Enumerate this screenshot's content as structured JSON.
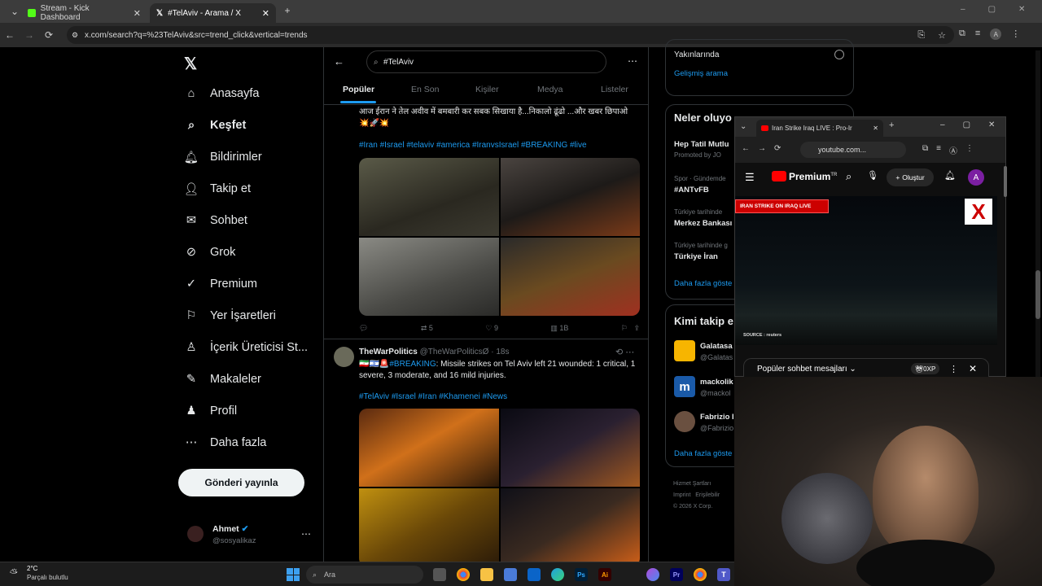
{
  "browser": {
    "tabs": [
      {
        "label": "Stream - Kick Dashboard",
        "icon": "kick-icon"
      },
      {
        "label": "#TelAviv - Arama / X",
        "icon": "x-icon"
      }
    ],
    "url": "x.com/search?q=%23TelAviv&src=trend_click&vertical=trends"
  },
  "sidebar": {
    "items": [
      {
        "label": "Anasayfa",
        "icon": "home-icon"
      },
      {
        "label": "Keşfet",
        "icon": "search-icon"
      },
      {
        "label": "Bildirimler",
        "icon": "bell-icon"
      },
      {
        "label": "Takip et",
        "icon": "follow-icon"
      },
      {
        "label": "Sohbet",
        "icon": "mail-icon"
      },
      {
        "label": "Grok",
        "icon": "grok-icon"
      },
      {
        "label": "Premium",
        "icon": "premium-icon"
      },
      {
        "label": "Yer İşaretleri",
        "icon": "bookmark-icon"
      },
      {
        "label": "İçerik Üreticisi St...",
        "icon": "creator-icon"
      },
      {
        "label": "Makaleler",
        "icon": "article-icon"
      },
      {
        "label": "Profil",
        "icon": "profile-icon"
      },
      {
        "label": "Daha fazla",
        "icon": "more-icon"
      }
    ],
    "post_button": "Gönderi yayınla",
    "account": {
      "name": "Ahmet",
      "handle": "@sosyalikaz"
    }
  },
  "search": {
    "query": "#TelAviv"
  },
  "search_tabs": [
    "Popüler",
    "En Son",
    "Kişiler",
    "Medya",
    "Listeler"
  ],
  "tweet1": {
    "text": "आज ईरान ने तेल अवीव में बमबारी कर सबक सिखाया है...निकालो ढूंढो ...और खबर छिपाओ",
    "emoji": "💥🚀💥",
    "tags": "#Iran #Israel #telaviv #america #IranvsIsrael #BREAKING #live",
    "replies": "",
    "retweets": "5",
    "likes": "9",
    "views": "1B"
  },
  "tweet2": {
    "name": "TheWarPolitics",
    "handle": "@TheWarPoliticsØ",
    "time": "· 18s",
    "flags": "🇮🇷🇮🇱🚨",
    "breaking": "#BREAKING",
    "text": ": Missile strikes on Tel Aviv left 21 wounded: 1 critical, 1 severe, 3 moderate, and 16 mild injuries.",
    "tags": "#TelAviv #Israel #Iran #Khamenei #News"
  },
  "right": {
    "filter_label": "Yakınlarında",
    "advanced_search": "Gelişmiş arama",
    "trends_title": "Neler oluyo",
    "trends": [
      {
        "meta": "",
        "name": "Hep Tatil Mutlu",
        "sub": "Promoted by JO"
      },
      {
        "meta": "Spor · Gündemde",
        "name": "#ANTvFB",
        "sub": ""
      },
      {
        "meta": "Türkiye tarihinde",
        "name": "Merkez Bankası",
        "sub": ""
      },
      {
        "meta": "Türkiye tarihinde g",
        "name": "Türkiye İran",
        "sub": ""
      }
    ],
    "show_more": "Daha fazla göste",
    "who_to_follow": "Kimi takip e",
    "follow": [
      {
        "name": "Galatasa",
        "handle": "@Galatas"
      },
      {
        "name": "mackolik",
        "handle": "@mackol"
      },
      {
        "name": "Fabrizio I",
        "handle": "@Fabrizio"
      }
    ],
    "show_more2": "Daha fazla göste",
    "footer": [
      "Hizmet Şartları",
      "Imprint",
      "Erişilebilir",
      "© 2026 X Corp."
    ]
  },
  "popup": {
    "tab_title": "Iran Strike Iraq LIVE : Pro-Ir",
    "url": "youtube.com...",
    "brand": "Premium",
    "brand_sup": "TR",
    "create_label": "Oluştur",
    "avatar_letter": "A",
    "live_banner": "IRAN STRIKE ON IRAQ LIVE",
    "source": "SOURCE : reuters",
    "chat_label": "Popüler sohbet mesajları",
    "xp": "0XP"
  },
  "taskbar": {
    "temp": "2°C",
    "weather": "Parçalı bulutlu",
    "search_placeholder": "Ara"
  },
  "colors": {
    "accent": "#1d9bf0",
    "bg": "#000000",
    "youtube_red": "#ff0000"
  }
}
